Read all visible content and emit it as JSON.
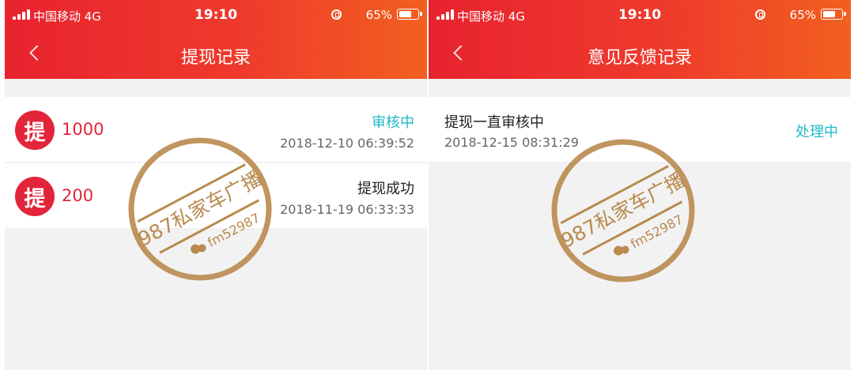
{
  "status_bar": {
    "carrier": "中国移动   4G",
    "time": "19:10",
    "battery": "65%"
  },
  "withdraw_screen": {
    "title": "提现记录",
    "records": [
      {
        "icon_char": "提",
        "amount": "1000",
        "status": "审核中",
        "time": "2018-12-10 06:39:52"
      },
      {
        "icon_char": "提",
        "amount": "200",
        "status": "提现成功",
        "time": "2018-11-19 06:33:33"
      }
    ]
  },
  "feedback_screen": {
    "title": "意见反馈记录",
    "records": [
      {
        "title": "提现一直审核中",
        "time": "2018-12-15 08:31:29",
        "status": "处理中"
      }
    ]
  },
  "watermark": {
    "main_text": "987私家车广播",
    "sub_text": "fm52987"
  },
  "colors": {
    "header_start": "#e8232f",
    "header_end": "#f2601f",
    "accent_red": "#e2253a",
    "status_teal": "#21b8c9",
    "stamp_brown": "#b98a4e"
  },
  "icons": {
    "back": "back-icon",
    "signal": "signal-icon",
    "lock": "lock-icon",
    "battery": "battery-icon",
    "wechat": "wechat-icon"
  }
}
